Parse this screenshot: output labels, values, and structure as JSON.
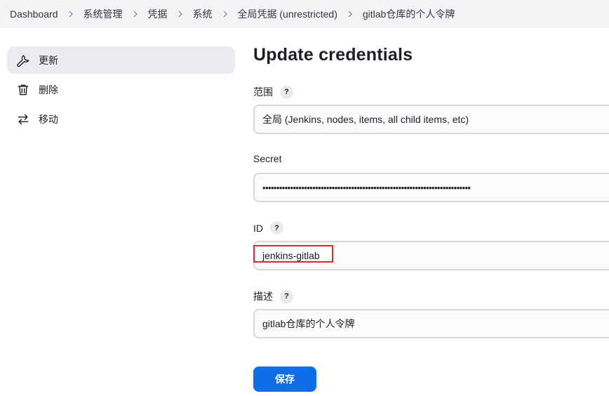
{
  "breadcrumb": [
    {
      "label": "Dashboard"
    },
    {
      "label": "系统管理"
    },
    {
      "label": "凭据"
    },
    {
      "label": "系统"
    },
    {
      "label": "全局凭据 (unrestricted)"
    },
    {
      "label": "gitlab仓库的个人令牌"
    }
  ],
  "sidebar": {
    "items": [
      {
        "label": "更新",
        "icon": "wrench-icon",
        "active": true
      },
      {
        "label": "删除",
        "icon": "trash-icon",
        "active": false
      },
      {
        "label": "移动",
        "icon": "swap-arrows-icon",
        "active": false
      }
    ]
  },
  "main": {
    "title": "Update credentials",
    "help_symbol": "?",
    "scope": {
      "label": "范围",
      "value": "全局 (Jenkins, nodes, items, all child items, etc)"
    },
    "secret": {
      "label": "Secret",
      "value": "•••••••••••••••••••••••••••••••••••••••••••••••••••••••••••••••••••••••••••"
    },
    "id": {
      "label": "ID",
      "value": "jenkins-gitlab"
    },
    "description": {
      "label": "描述",
      "value": "gitlab仓库的个人令牌"
    },
    "save_label": "保存"
  },
  "colors": {
    "accent": "#0d6ee8",
    "highlight": "#e0262a",
    "breadcrumb_bg": "#f4f4f6",
    "active_item_bg": "#ececf0"
  }
}
